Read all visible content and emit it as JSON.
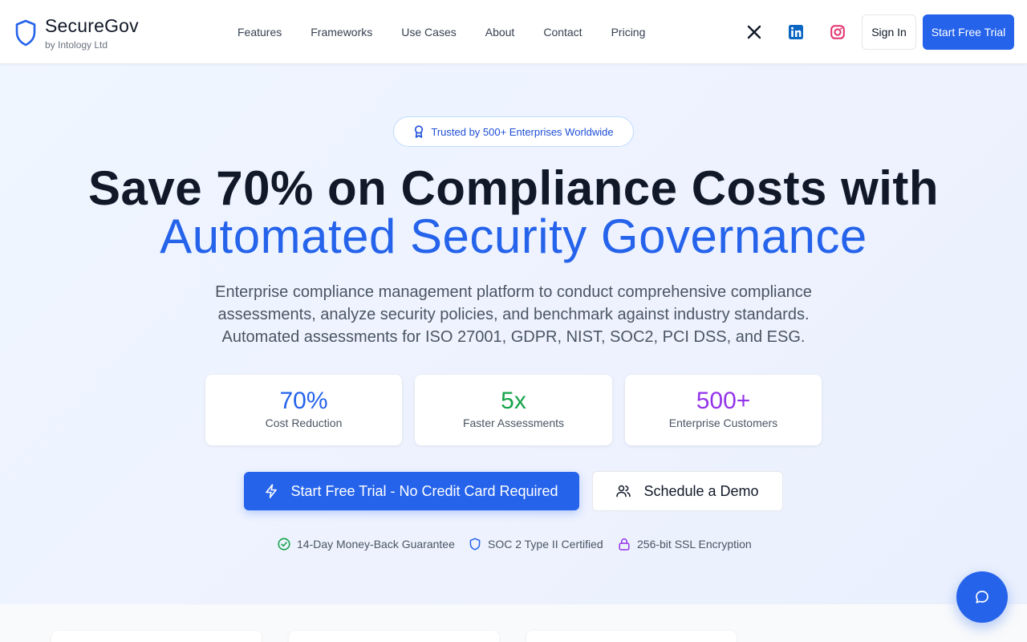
{
  "header": {
    "brand": "SecureGov",
    "brand_sub": "by Intology Ltd",
    "nav": [
      "Features",
      "Frameworks",
      "Use Cases",
      "About",
      "Contact",
      "Pricing"
    ],
    "social_icons": [
      "x-icon",
      "linkedin-icon",
      "instagram-icon"
    ],
    "sign_in": "Sign In",
    "start_trial": "Start Free Trial"
  },
  "hero": {
    "badge": "Trusted by 500+ Enterprises Worldwide",
    "title_line1": "Save 70% on Compliance Costs with",
    "title_line2": "Automated Security Governance",
    "description": "Enterprise compliance management platform to conduct comprehensive compliance assessments, analyze security policies, and benchmark against industry standards. Automated assessments for ISO 27001, GDPR, NIST, SOC2, PCI DSS, and ESG.",
    "stats": [
      {
        "value": "70%",
        "label": "Cost Reduction",
        "color": "#2563eb"
      },
      {
        "value": "5x",
        "label": "Faster Assessments",
        "color": "#16a34a"
      },
      {
        "value": "500+",
        "label": "Enterprise Customers",
        "color": "#9333ea"
      }
    ],
    "cta_primary": "Start Free Trial - No Credit Card Required",
    "cta_secondary": "Schedule a Demo",
    "trust": [
      {
        "label": "14-Day Money-Back Guarantee",
        "icon": "check-circle-icon",
        "color": "#16a34a"
      },
      {
        "label": "SOC 2 Type II Certified",
        "icon": "shield-icon",
        "color": "#2563eb"
      },
      {
        "label": "256-bit SSL Encryption",
        "icon": "lock-icon",
        "color": "#9333ea"
      }
    ]
  },
  "colors": {
    "accent": "#2563eb",
    "green": "#16a34a",
    "purple": "#9333ea",
    "instagram": "#e1306c",
    "linkedin": "#0a66c2"
  }
}
